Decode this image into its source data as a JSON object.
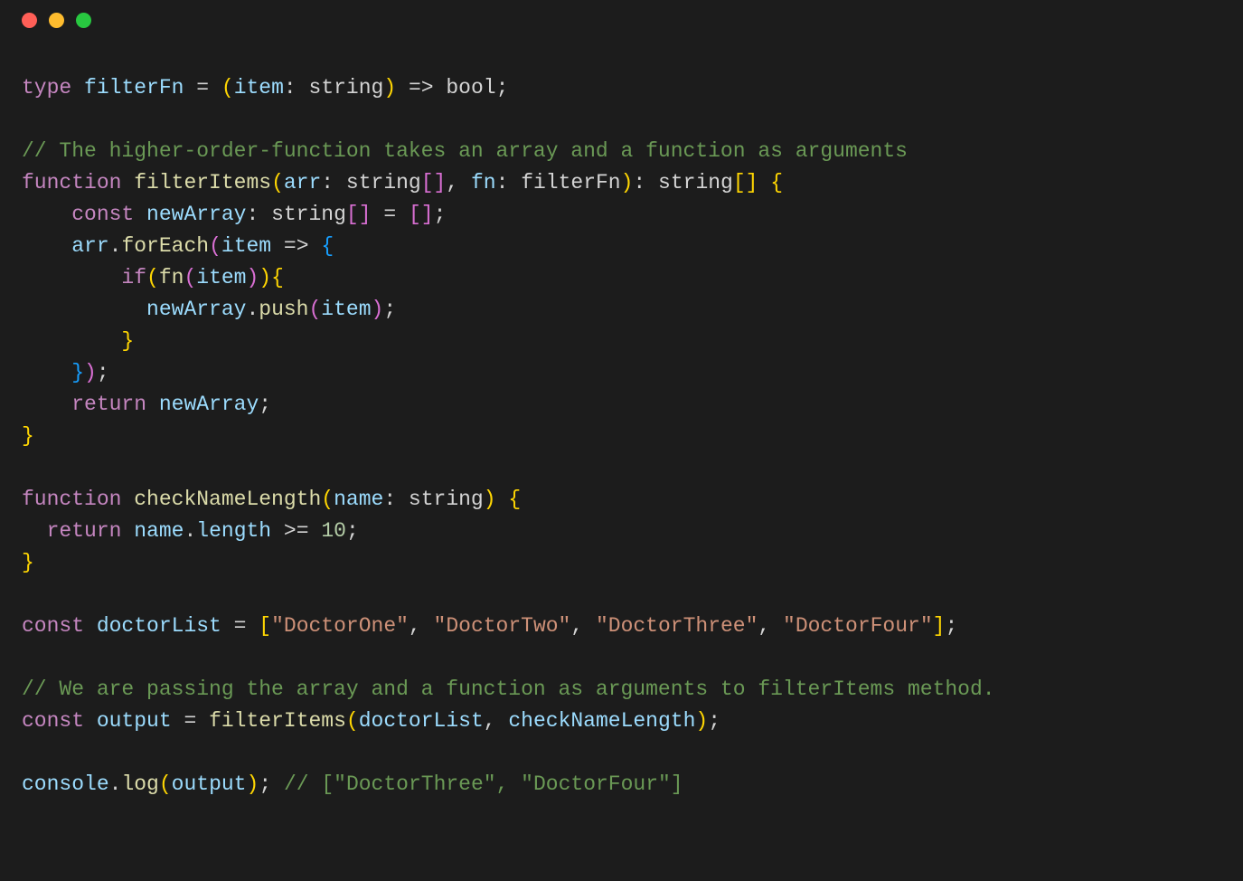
{
  "titlebar": {
    "buttons": [
      "close",
      "minimize",
      "zoom"
    ]
  },
  "code": {
    "l01_type": "type",
    "l01_name": "filterFn",
    "l01_eq": " = ",
    "l01_open": "(",
    "l01_param": "item",
    "l01_colon": ": ",
    "l01_ptype": "string",
    "l01_close": ")",
    "l01_arrow": " => ",
    "l01_ret": "bool",
    "l01_semi": ";",
    "l03_comment": "// The higher-order-function takes an array and a function as arguments",
    "l04_function": "function",
    "l04_fname": "filterItems",
    "l04_open": "(",
    "l04_p1": "arr",
    "l04_c1": ": ",
    "l04_t1": "string",
    "l04_b1o": "[",
    "l04_b1c": "]",
    "l04_comma": ", ",
    "l04_p2": "fn",
    "l04_c2": ": ",
    "l04_t2": "filterFn",
    "l04_close": ")",
    "l04_c3": ": ",
    "l04_rt": "string",
    "l04_b2o": "[",
    "l04_b2c": "]",
    "l04_brace": " {",
    "l05_indent": "    ",
    "l05_const": "const",
    "l05_var": "newArray",
    "l05_colon": ": ",
    "l05_type": "string",
    "l05_b1o": "[",
    "l05_b1c": "]",
    "l05_eq": " = ",
    "l05_b2o": "[",
    "l05_b2c": "]",
    "l05_semi": ";",
    "l06_indent": "    ",
    "l06_obj": "arr",
    "l06_dot": ".",
    "l06_method": "forEach",
    "l06_open": "(",
    "l06_param": "item",
    "l06_arrow": " => ",
    "l06_brace": "{",
    "l07_indent": "        ",
    "l07_if": "if",
    "l07_open": "(",
    "l07_fn": "fn",
    "l07_open2": "(",
    "l07_arg": "item",
    "l07_close2": ")",
    "l07_close": ")",
    "l07_brace": "{",
    "l08_indent": "          ",
    "l08_obj": "newArray",
    "l08_dot": ".",
    "l08_method": "push",
    "l08_open": "(",
    "l08_arg": "item",
    "l08_close": ")",
    "l08_semi": ";",
    "l09_indent": "        ",
    "l09_brace": "}",
    "l10_indent": "    ",
    "l10_brace": "}",
    "l10_close": ")",
    "l10_semi": ";",
    "l11_indent": "    ",
    "l11_return": "return",
    "l11_var": "newArray",
    "l11_semi": ";",
    "l12_brace": "}",
    "l14_function": "function",
    "l14_fname": "checkNameLength",
    "l14_open": "(",
    "l14_p1": "name",
    "l14_c1": ": ",
    "l14_t1": "string",
    "l14_close": ")",
    "l14_brace": " {",
    "l15_indent": "  ",
    "l15_return": "return",
    "l15_obj": "name",
    "l15_dot": ".",
    "l15_prop": "length",
    "l15_op": " >= ",
    "l15_num": "10",
    "l15_semi": ";",
    "l16_brace": "}",
    "l18_const": "const",
    "l18_var": "doctorList",
    "l18_eq": " = ",
    "l18_open": "[",
    "l18_s1": "\"DoctorOne\"",
    "l18_c1": ", ",
    "l18_s2": "\"DoctorTwo\"",
    "l18_c2": ", ",
    "l18_s3": "\"DoctorThree\"",
    "l18_c3": ", ",
    "l18_s4": "\"DoctorFour\"",
    "l18_close": "]",
    "l18_semi": ";",
    "l20_comment": "// We are passing the array and a function as arguments to filterItems method.",
    "l21_const": "const",
    "l21_var": "output",
    "l21_eq": " = ",
    "l21_fn": "filterItems",
    "l21_open": "(",
    "l21_a1": "doctorList",
    "l21_comma": ", ",
    "l21_a2": "checkNameLength",
    "l21_close": ")",
    "l21_semi": ";",
    "l23_obj": "console",
    "l23_dot": ".",
    "l23_method": "log",
    "l23_open": "(",
    "l23_arg": "output",
    "l23_close": ")",
    "l23_semi": ";",
    "l23_sp": " ",
    "l23_comment": "// [\"DoctorThree\", \"DoctorFour\"]"
  }
}
